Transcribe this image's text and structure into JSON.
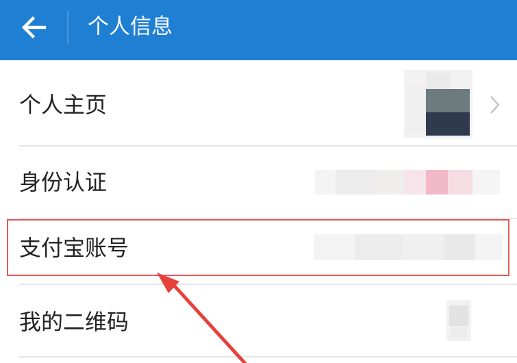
{
  "header": {
    "back_icon": "arrow-left-icon",
    "title": "个人信息",
    "background": "#1f7fd3"
  },
  "rows": [
    {
      "label": "个人主页",
      "value": "avatar image (blurred)",
      "has_chevron": true
    },
    {
      "label": "身份认证",
      "value": "blurred"
    },
    {
      "label": "支付宝账号",
      "value": "blurred",
      "highlighted": true
    },
    {
      "label": "我的二维码",
      "value": "qr-code-icon (blurred)"
    }
  ],
  "annotation": {
    "highlight_color": "#e25a5a",
    "arrow_color": "#e8403a",
    "points_to": "支付宝账号"
  }
}
